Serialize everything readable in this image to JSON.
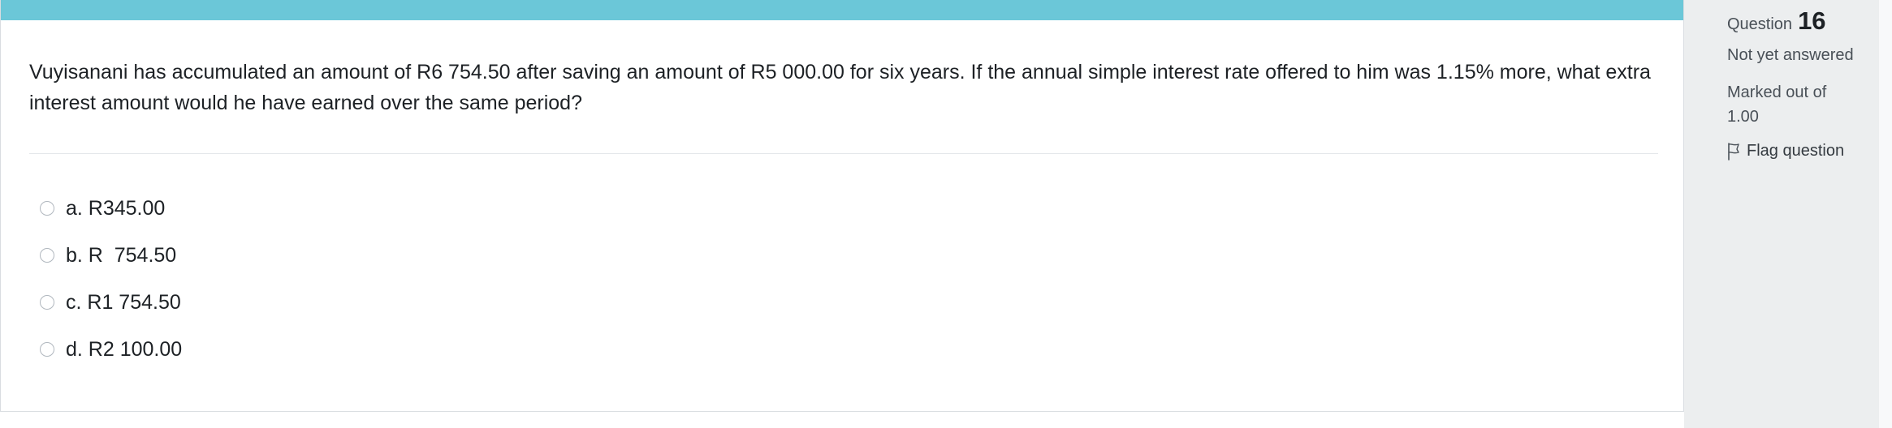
{
  "question": {
    "text": "Vuyisanani has accumulated an amount of R6 754.50 after saving an amount of R5 000.00 for six years. If the annual simple interest rate offered to him was 1.15% more, what extra interest amount would he have earned over the same period?",
    "answers": [
      {
        "label": "a. R345.00"
      },
      {
        "label": "b. R  754.50"
      },
      {
        "label": "c. R1 754.50"
      },
      {
        "label": "d. R2 100.00"
      }
    ]
  },
  "info": {
    "question_word": "Question",
    "question_number": "16",
    "state": "Not yet answered",
    "grade": "Marked out of 1.00",
    "flag_label": "Flag question",
    "flag_icon": "flag-outline-icon"
  },
  "colors": {
    "accent_band": "#6bc7d8",
    "panel_background": "#eceeef",
    "text": "#1d2125"
  }
}
